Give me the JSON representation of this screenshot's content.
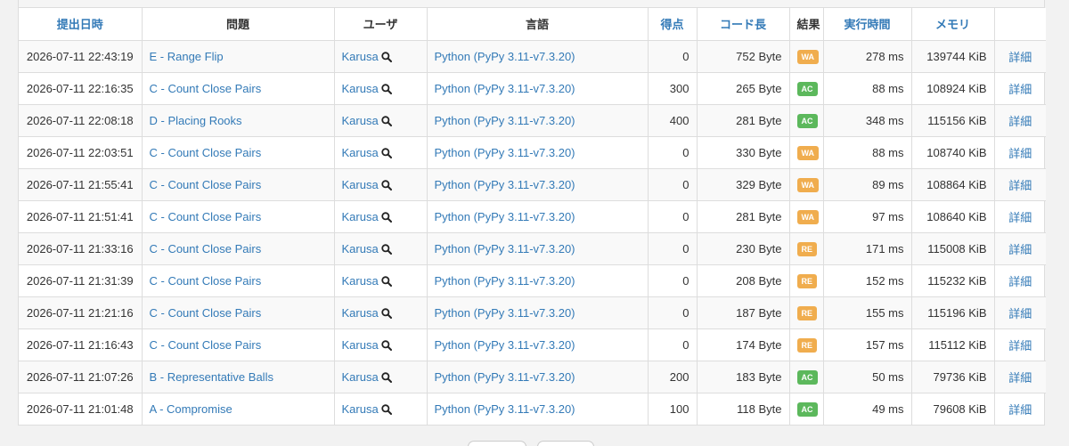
{
  "table": {
    "headers": {
      "submitted": "提出日時",
      "problem": "問題",
      "user": "ユーザ",
      "language": "言語",
      "score": "得点",
      "code_length": "コード長",
      "result": "結果",
      "exec_time": "実行時間",
      "memory": "メモリ",
      "detail": ""
    },
    "rows": [
      {
        "submitted": "2026-07-11 22:43:19",
        "problem": "E - Range Flip",
        "user": "Karusa",
        "language": "Python (PyPy 3.11-v7.3.20)",
        "score": "0",
        "code_length": "752 Byte",
        "result": "WA",
        "exec_time": "278 ms",
        "memory": "139744 KiB",
        "detail": "詳細"
      },
      {
        "submitted": "2026-07-11 22:16:35",
        "problem": "C - Count Close Pairs",
        "user": "Karusa",
        "language": "Python (PyPy 3.11-v7.3.20)",
        "score": "300",
        "code_length": "265 Byte",
        "result": "AC",
        "exec_time": "88 ms",
        "memory": "108924 KiB",
        "detail": "詳細"
      },
      {
        "submitted": "2026-07-11 22:08:18",
        "problem": "D - Placing Rooks",
        "user": "Karusa",
        "language": "Python (PyPy 3.11-v7.3.20)",
        "score": "400",
        "code_length": "281 Byte",
        "result": "AC",
        "exec_time": "348 ms",
        "memory": "115156 KiB",
        "detail": "詳細"
      },
      {
        "submitted": "2026-07-11 22:03:51",
        "problem": "C - Count Close Pairs",
        "user": "Karusa",
        "language": "Python (PyPy 3.11-v7.3.20)",
        "score": "0",
        "code_length": "330 Byte",
        "result": "WA",
        "exec_time": "88 ms",
        "memory": "108740 KiB",
        "detail": "詳細"
      },
      {
        "submitted": "2026-07-11 21:55:41",
        "problem": "C - Count Close Pairs",
        "user": "Karusa",
        "language": "Python (PyPy 3.11-v7.3.20)",
        "score": "0",
        "code_length": "329 Byte",
        "result": "WA",
        "exec_time": "89 ms",
        "memory": "108864 KiB",
        "detail": "詳細"
      },
      {
        "submitted": "2026-07-11 21:51:41",
        "problem": "C - Count Close Pairs",
        "user": "Karusa",
        "language": "Python (PyPy 3.11-v7.3.20)",
        "score": "0",
        "code_length": "281 Byte",
        "result": "WA",
        "exec_time": "97 ms",
        "memory": "108640 KiB",
        "detail": "詳細"
      },
      {
        "submitted": "2026-07-11 21:33:16",
        "problem": "C - Count Close Pairs",
        "user": "Karusa",
        "language": "Python (PyPy 3.11-v7.3.20)",
        "score": "0",
        "code_length": "230 Byte",
        "result": "RE",
        "exec_time": "171 ms",
        "memory": "115008 KiB",
        "detail": "詳細"
      },
      {
        "submitted": "2026-07-11 21:31:39",
        "problem": "C - Count Close Pairs",
        "user": "Karusa",
        "language": "Python (PyPy 3.11-v7.3.20)",
        "score": "0",
        "code_length": "208 Byte",
        "result": "RE",
        "exec_time": "152 ms",
        "memory": "115232 KiB",
        "detail": "詳細"
      },
      {
        "submitted": "2026-07-11 21:21:16",
        "problem": "C - Count Close Pairs",
        "user": "Karusa",
        "language": "Python (PyPy 3.11-v7.3.20)",
        "score": "0",
        "code_length": "187 Byte",
        "result": "RE",
        "exec_time": "155 ms",
        "memory": "115196 KiB",
        "detail": "詳細"
      },
      {
        "submitted": "2026-07-11 21:16:43",
        "problem": "C - Count Close Pairs",
        "user": "Karusa",
        "language": "Python (PyPy 3.11-v7.3.20)",
        "score": "0",
        "code_length": "174 Byte",
        "result": "RE",
        "exec_time": "157 ms",
        "memory": "115112 KiB",
        "detail": "詳細"
      },
      {
        "submitted": "2026-07-11 21:07:26",
        "problem": "B - Representative Balls",
        "user": "Karusa",
        "language": "Python (PyPy 3.11-v7.3.20)",
        "score": "200",
        "code_length": "183 Byte",
        "result": "AC",
        "exec_time": "50 ms",
        "memory": "79736 KiB",
        "detail": "詳細"
      },
      {
        "submitted": "2026-07-11 21:01:48",
        "problem": "A - Compromise",
        "user": "Karusa",
        "language": "Python (PyPy 3.11-v7.3.20)",
        "score": "100",
        "code_length": "118 Byte",
        "result": "AC",
        "exec_time": "49 ms",
        "memory": "79608 KiB",
        "detail": "詳細"
      }
    ]
  },
  "colors": {
    "link": "#337ab7",
    "wa": "#f0ad4e",
    "re": "#f0ad4e",
    "ac": "#5cb85c"
  },
  "icons": {
    "user_search": "search-icon"
  }
}
